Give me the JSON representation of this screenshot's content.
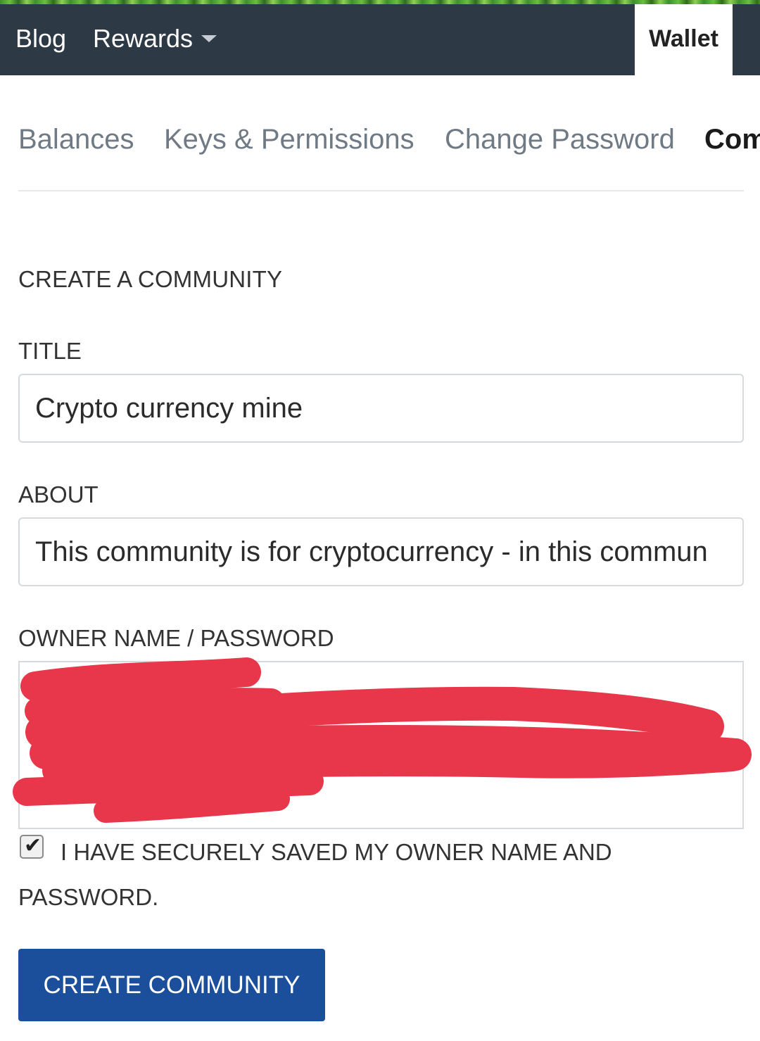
{
  "topbar": {
    "blog_label": "Blog",
    "rewards_label": "Rewards",
    "wallet_label": "Wallet"
  },
  "subnav": {
    "balances": "Balances",
    "keys": "Keys & Permissions",
    "change_password": "Change Password",
    "community": "Com"
  },
  "form": {
    "heading": "CREATE A COMMUNITY",
    "title_label": "TITLE",
    "title_value": "Crypto currency mine",
    "about_label": "ABOUT",
    "about_value": "This community is for cryptocurrency - in this commun",
    "owner_label": "OWNER NAME / PASSWORD",
    "checkbox_checked": true,
    "checkbox_label_line1": "I HAVE SECURELY SAVED MY OWNER NAME AND",
    "checkbox_label_line2": "PASSWORD.",
    "submit_label": "CREATE COMMUNITY"
  },
  "colors": {
    "topbar_bg": "#2d3a46",
    "button_bg": "#1b4f9b",
    "redaction": "#e8364a"
  }
}
